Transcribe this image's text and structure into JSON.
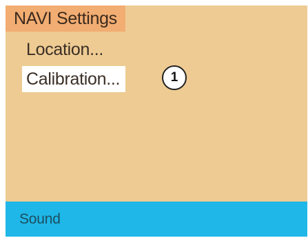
{
  "screen": {
    "title": "NAVI Settings",
    "menu_items": [
      {
        "label": "Location...",
        "selected": false
      },
      {
        "label": "Calibration...",
        "selected": true
      }
    ],
    "callout_number": "1",
    "bottom_label": "Sound"
  },
  "colors": {
    "background": "#eecb93",
    "title_highlight": "#f2ad72",
    "selected_item": "#ffffff",
    "bottom_bar": "#1fb7e8"
  }
}
